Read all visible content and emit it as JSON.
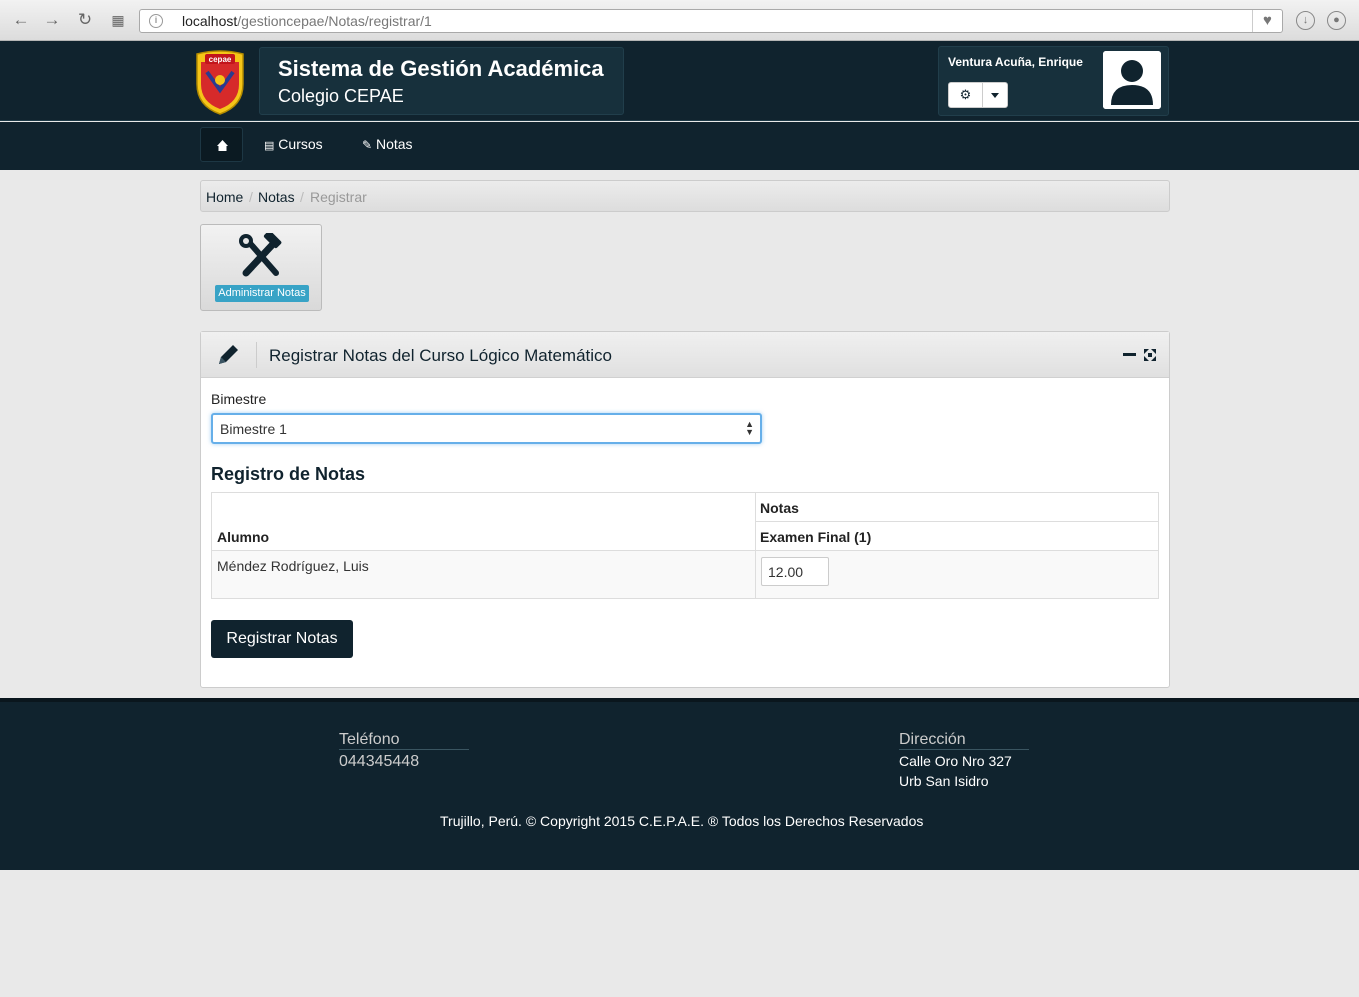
{
  "browser": {
    "url_host": "localhost",
    "url_path": "/gestioncepae/Notas/registrar/1"
  },
  "header": {
    "title": "Sistema de Gestión Académica",
    "subtitle": "Colegio CEPAE",
    "logo_text": "cepae",
    "user_name": "Ventura Acuña, Enrique"
  },
  "nav": {
    "items": [
      {
        "label": "Cursos",
        "icon": "list-icon"
      },
      {
        "label": "Notas",
        "icon": "edit-icon"
      }
    ]
  },
  "breadcrumb": {
    "items": [
      "Home",
      "Notas"
    ],
    "active": "Registrar"
  },
  "shortcut": {
    "label": "Administrar Notas"
  },
  "panel": {
    "title": "Registrar Notas del Curso Lógico Matemático",
    "bimestre_label": "Bimestre",
    "bimestre_value": "Bimestre 1",
    "section_title": "Registro de Notas",
    "table": {
      "col_student": "Alumno",
      "group_header": "Notas",
      "col_exam": "Examen Final (1)",
      "rows": [
        {
          "student": "Méndez Rodríguez, Luis",
          "grade": "12.00"
        }
      ]
    },
    "submit_label": "Registrar Notas"
  },
  "footer": {
    "phone_label": "Teléfono",
    "phone": "044345448",
    "address_label": "Dirección",
    "address_line1": "Calle Oro Nro 327",
    "address_line2": "Urb San Isidro",
    "copyright": "Trujillo, Perú. © Copyright 2015 C.E.P.A.E. ® Todos los Derechos Reservados"
  },
  "colors": {
    "primary": "#10232e",
    "accent": "#38a3c6",
    "background": "#e9e9e9"
  }
}
